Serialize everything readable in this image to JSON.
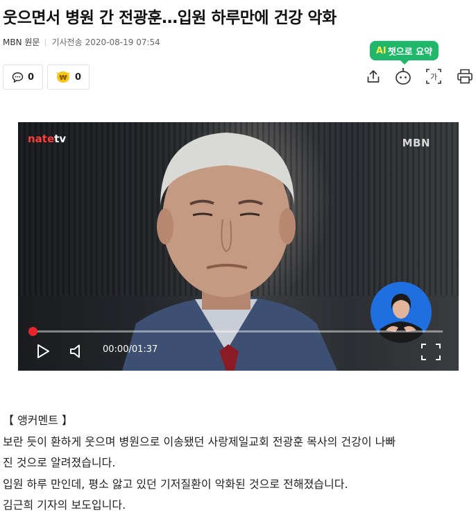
{
  "article": {
    "title": "웃으면서 병원 간 전광훈…입원 하루만에 건강 악화",
    "source": "MBN 원문",
    "timestamp_label": "기사전송",
    "timestamp": "2020-08-19 07:54"
  },
  "reactions": {
    "comment_count": "0",
    "coin_count": "0",
    "coin_glyph": "₩"
  },
  "ai_badge": {
    "ai": "AI",
    "label": "챗으로 요약"
  },
  "toolbar": {
    "share_icon": "share-icon",
    "robot_icon": "robot-icon",
    "font_icon": "font-size-icon",
    "print_icon": "print-icon",
    "font_glyph": "가"
  },
  "video": {
    "watermark_left": "nate",
    "watermark_left_tv": "tv",
    "watermark_right": "MBN",
    "time": "00:00/01:37",
    "progress": 0.0
  },
  "body": {
    "lines": [
      "【 앵커멘트 】",
      "보란 듯이 환하게 웃으며 병원으로 이송됐던 사랑제일교회 전광훈 목사의 건강이 나빠",
      "진 것으로 알려졌습니다.",
      "입원 하루 만인데, 평소 앓고 있던 기저질환이 악화된 것으로 전해졌습니다.",
      "김근희 기자의 보도입니다."
    ]
  },
  "colors": {
    "accent_green": "#1fb86a",
    "progress_red": "#e8262a",
    "coin_yellow": "#f5c518"
  }
}
